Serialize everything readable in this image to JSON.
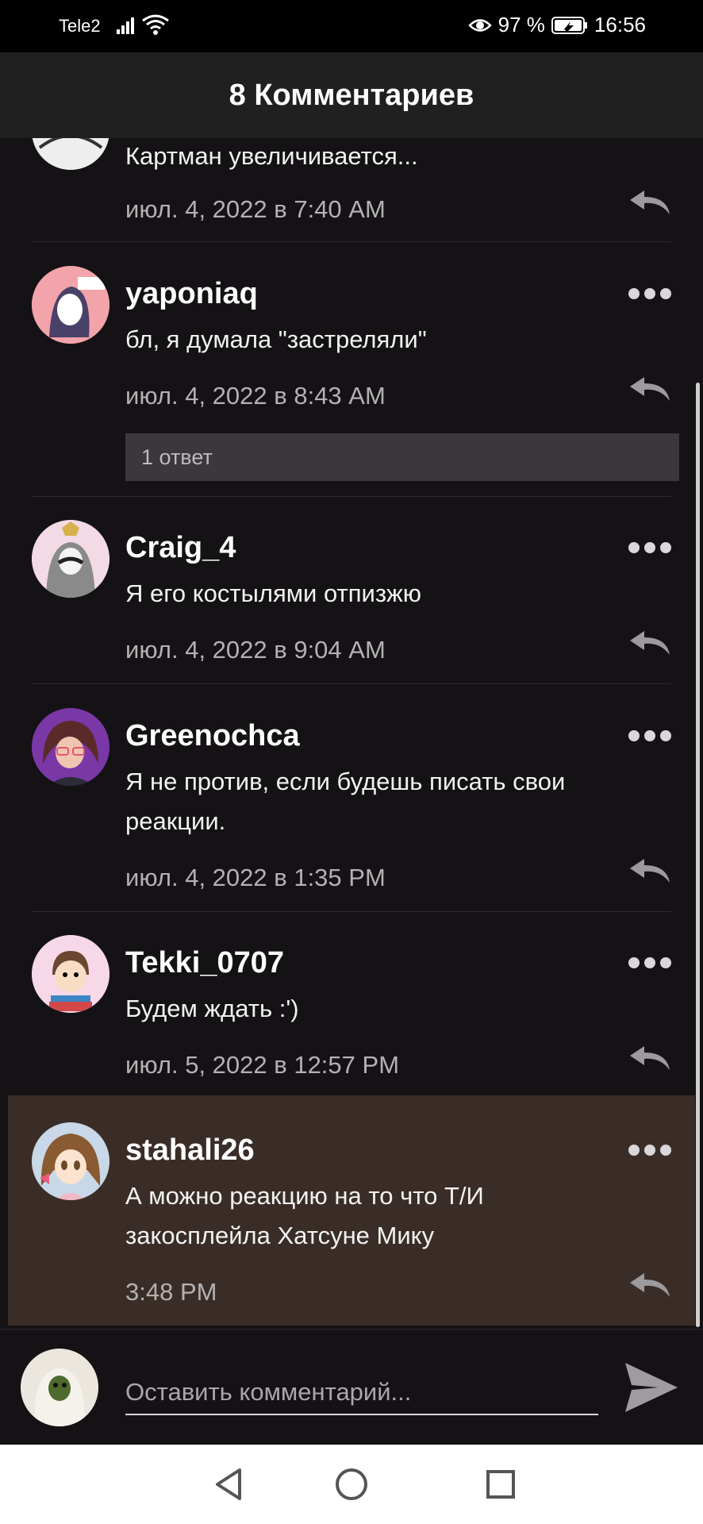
{
  "status": {
    "carrier": "Tele2",
    "battery": "97 %",
    "time": "16:56"
  },
  "header": {
    "title": "8 Комментариев"
  },
  "comments": [
    {
      "username": "",
      "text": "Картман увеличивается...",
      "date": "июл. 4, 2022 в 7:40 AM"
    },
    {
      "username": "yaponiaq",
      "text": "бл, я думала \"застреляли\"",
      "date": "июл. 4, 2022 в 8:43 AM",
      "replies": "1 ответ"
    },
    {
      "username": "Craig_4",
      "text": "Я его костылями отпизжю",
      "date": "июл. 4, 2022 в 9:04 AM"
    },
    {
      "username": "Greenochca",
      "text": "Я не против, если будешь писать свои реакции.",
      "date": "июл. 4, 2022 в 1:35 PM"
    },
    {
      "username": "Tekki_0707",
      "text": "Будем ждать :')",
      "date": "июл. 5, 2022 в 12:57 PM"
    },
    {
      "username": "stahali26",
      "text": "А можно реакцию на то что Т/И закосплейла Хатсуне Мику",
      "date": "3:48 PM"
    }
  ],
  "composer": {
    "placeholder": "Оставить комментарий..."
  },
  "icons": {
    "eye": "eye-icon",
    "battery": "battery-icon",
    "signal": "signal-icon",
    "wifi": "wifi-icon",
    "more": "more-dots-icon",
    "reply": "reply-icon",
    "send": "send-icon",
    "back": "nav-back-icon",
    "home": "nav-home-icon",
    "recents": "nav-recents-icon"
  },
  "colors": {
    "background": "#151215",
    "header": "#202020",
    "highlight": "#3a2d27",
    "repliesButton": "#3a383a"
  }
}
